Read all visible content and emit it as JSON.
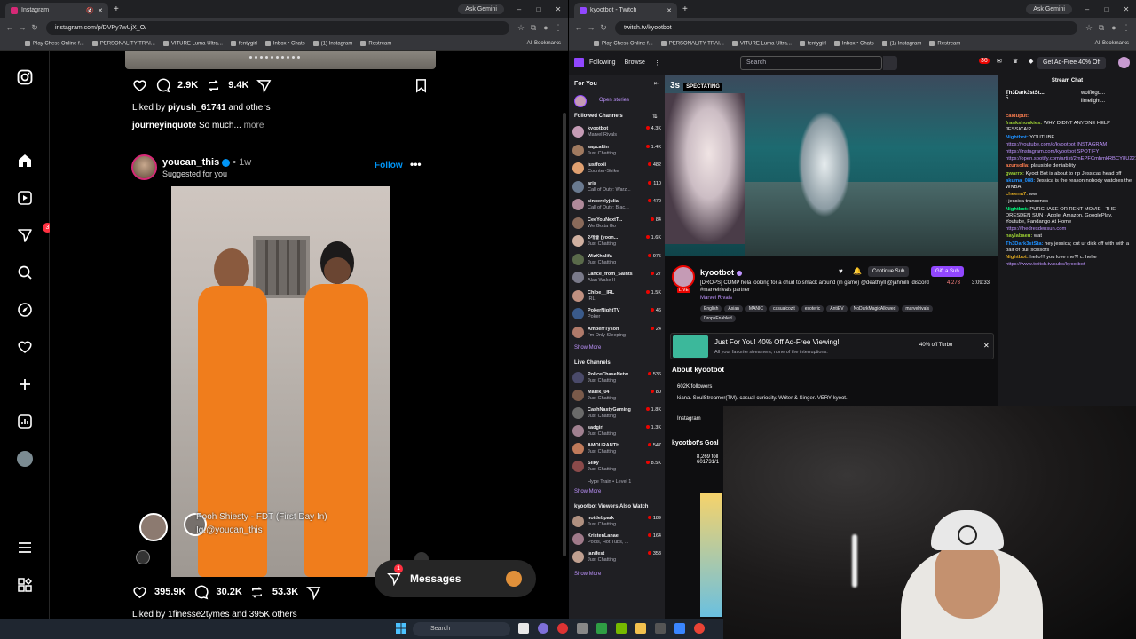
{
  "left_window": {
    "tab_title": "Instagram",
    "gemini_label": "Ask Gemini",
    "url": "instagram.com/p/DVPy7wUjX_O/",
    "bookmarks": [
      "Play Chess Online f...",
      "PERSONALITY TRAI...",
      "VITURE Luma Ultra...",
      "fentygirl",
      "Inbox • Chats",
      "(1) Instagram",
      "Restream"
    ],
    "all_bookmarks": "All Bookmarks"
  },
  "instagram": {
    "sidebar_badge": "3",
    "post1": {
      "comments": "2.9K",
      "reposts": "9.4K",
      "liked_prefix": "Liked by ",
      "liked_user": "piyush_61741",
      "liked_suffix": " and others",
      "caption_user": "journeyinquote",
      "caption_text": " So much...",
      "more": " more"
    },
    "post2": {
      "username": "youcan_this",
      "time": " • 1w",
      "suggested": "Suggested for you",
      "follow": "Follow",
      "sub_line1": "Pooh Shiesty - FDT (First Day In)",
      "sub_line2": "Ig:@youcan_this",
      "likes": "395.9K",
      "comments": "30.2K",
      "reposts": "53.3K",
      "liked_line": "Liked by 1finesse2tymes and 395K others"
    },
    "messages_label": "Messages",
    "messages_badge": "1"
  },
  "right_window": {
    "tab_title": "kyootbot - Twitch",
    "gemini_label": "Ask Gemini",
    "url": "twitch.tv/kyootbot",
    "bookmarks": [
      "Play Chess Online f...",
      "PERSONALITY TRAI...",
      "VITURE Luma Ultra...",
      "fentygirl",
      "Inbox • Chats",
      "(1) Instagram",
      "Restream"
    ],
    "all_bookmarks": "All Bookmarks"
  },
  "twitch": {
    "nav_following": "Following",
    "nav_browse": "Browse",
    "search_placeholder": "Search",
    "notif_count": "36",
    "ad_free": "Get Ad-Free 40% Off",
    "for_you": "For You",
    "open_stories": "Open stories",
    "followed_channels": "Followed Channels",
    "followed": [
      {
        "name": "kyootbot",
        "game": "Marvel Rivals",
        "viewers": "4.3K",
        "color": "#c59bb5"
      },
      {
        "name": "sapcaltin",
        "game": "Just Chatting",
        "viewers": "1.4K",
        "color": "#a07a60"
      },
      {
        "name": "justfoxii",
        "game": "Counter-Strike",
        "viewers": "482",
        "color": "#e0a070"
      },
      {
        "name": "aris",
        "game": "Call of Duty: Warz...",
        "viewers": "110",
        "color": "#6a7a90"
      },
      {
        "name": "sincerelyjulia",
        "game": "Call of Duty: Blac...",
        "viewers": "470",
        "color": "#b08a9a"
      },
      {
        "name": "CeeYouNextT...",
        "game": "We Gotta Go",
        "viewers": "84",
        "color": "#8a6a5a"
      },
      {
        "name": "2개을 (yoon...",
        "game": "Just Chatting",
        "viewers": "1.6K",
        "color": "#d0b0a0"
      },
      {
        "name": "WizKhalifa",
        "game": "Just Chatting",
        "viewers": "975",
        "color": "#5a6a4a"
      },
      {
        "name": "Lance_from_Saints",
        "game": "Alan Wake II",
        "viewers": "27",
        "color": "#7a7a8a"
      },
      {
        "name": "Chloe__IRL",
        "game": "IRL",
        "viewers": "1.5K",
        "color": "#c09080"
      },
      {
        "name": "PokerNightTV",
        "game": "Poker",
        "viewers": "46",
        "color": "#3a5a8a"
      },
      {
        "name": "AmberrTyson",
        "game": "I'm Only Sleeping",
        "viewers": "24",
        "color": "#b07a6a"
      }
    ],
    "show_more_1": "Show More",
    "live_channels": "Live Channels",
    "live": [
      {
        "name": "PoliceChaseNetw...",
        "game": "Just Chatting",
        "viewers": "536",
        "color": "#4a4a6a"
      },
      {
        "name": "Malek_04",
        "game": "Just Chatting",
        "viewers": "80",
        "color": "#7a5a4a"
      },
      {
        "name": "CashNastyGaming",
        "game": "Just Chatting",
        "viewers": "1.8K",
        "color": "#6a6a6a"
      },
      {
        "name": "sadgirl",
        "game": "Just Chatting",
        "viewers": "1.3K",
        "color": "#a08090"
      },
      {
        "name": "AMOURANTH",
        "game": "Just Chatting",
        "viewers": "547",
        "color": "#c07a5a"
      },
      {
        "name": "Silky",
        "game": "Just Chatting",
        "viewers": "8.5K",
        "color": "#8a4a4a"
      }
    ],
    "hype_train": "Hype Train • Level 1",
    "show_more_2": "Show More",
    "also_watch": "kyootbot Viewers Also Watch",
    "also": [
      {
        "name": "notdebpark",
        "game": "Just Chatting",
        "viewers": "189",
        "color": "#b09080"
      },
      {
        "name": "KristenLanae",
        "game": "Pools, Hot Tubs, ...",
        "viewers": "164",
        "color": "#a07a8a"
      },
      {
        "name": "janifest",
        "game": "Just Chatting",
        "viewers": "353",
        "color": "#c0a090"
      }
    ],
    "show_more_3": "Show More",
    "spectating_time": "3s",
    "spectating_label": "SPECTATING",
    "streamer": "kyootbot",
    "stream_title": "[DROPS] COMP hela looking for a chud to smack around (in game) @deathlyll @jahmilli !discord #marvelrivals partner",
    "game": "Marvel Rivals",
    "tags": [
      "English",
      "Asian",
      "MANIC",
      "casualcozit",
      "esoteric",
      "AntiEV",
      "NoDarkMagicAllowed",
      "marvelrivals",
      "DropsEnabled"
    ],
    "continue_sub": "Continue Sub",
    "gift_sub": "Gift a Sub",
    "viewers": "4,273",
    "uptime": "3:09:33",
    "promo_title": "Just For You! 40% Off Ad-Free Viewing!",
    "promo_sub": "All your favorite streamers, none of the interruptions.",
    "promo_turbo": "40% off Turbo",
    "about": "About kyootbot",
    "followers": "602K followers",
    "bio": "kiana. SoulStreamer(TM). casual curiosity. Writer & Singer. VERY kyoot.",
    "ig_link": "Instagram",
    "goals": "kyootbot's Goal",
    "goal_num": "8,269 foll",
    "goal_num2": "601731/1",
    "chat_header": "Stream Chat",
    "pin_user": "Th3Dark3stSt...",
    "pin_count": "5",
    "pin_user2": "wolfiego...",
    "pin_user3": "limelight...",
    "chat": [
      {
        "user": "calduput:",
        "text": ""
      },
      {
        "user": "frankshonkies:",
        "text": " WHY DIDNT ANYONE HELP JESSICA!?"
      },
      {
        "user": "Nightbot:",
        "text": " YOUTUBE"
      },
      {
        "user": "",
        "text": "https://youtube.com/c/kyootbot INSTAGRAM"
      },
      {
        "user": "",
        "text": "https://instagram.com/kyootbot SPOTIFY"
      },
      {
        "user": "",
        "text": "https://open.spotify.com/artist/2mEPFCmhmkRBCY8U221AED"
      },
      {
        "user": "azursolla:",
        "text": " plausible deniability"
      },
      {
        "user": "gwarrx:",
        "text": " Kyoot Bot is about to rip Jessicas head off"
      },
      {
        "user": "akuma_088:",
        "text": " Jessica is the reason nobody watches the WNBA"
      },
      {
        "user": "cheena7:",
        "text": " ww"
      },
      {
        "user": "",
        "text": ": jessica transends"
      },
      {
        "user": "Nightbot:",
        "text": " PURCHASE OR RENT MOVIE - THE DRESDEN SUN - Apple, Amazon, GooglePlay, Youtube, Fandango At Home"
      },
      {
        "user": "",
        "text": "https://thedresdensun.com"
      },
      {
        "user": "naylabaeu:",
        "text": " wat"
      },
      {
        "user": "Th3Dark3stSta:",
        "text": " hey jessica; cut ur dick off with with a pair of dull scissors"
      },
      {
        "user": "Nightbot:",
        "text": " hello!!! you love me?! c: hehe"
      },
      {
        "user": "",
        "text": "https://www.twitch.tv/subs/kyootbot"
      }
    ]
  },
  "taskbar": {
    "search": "Search"
  }
}
